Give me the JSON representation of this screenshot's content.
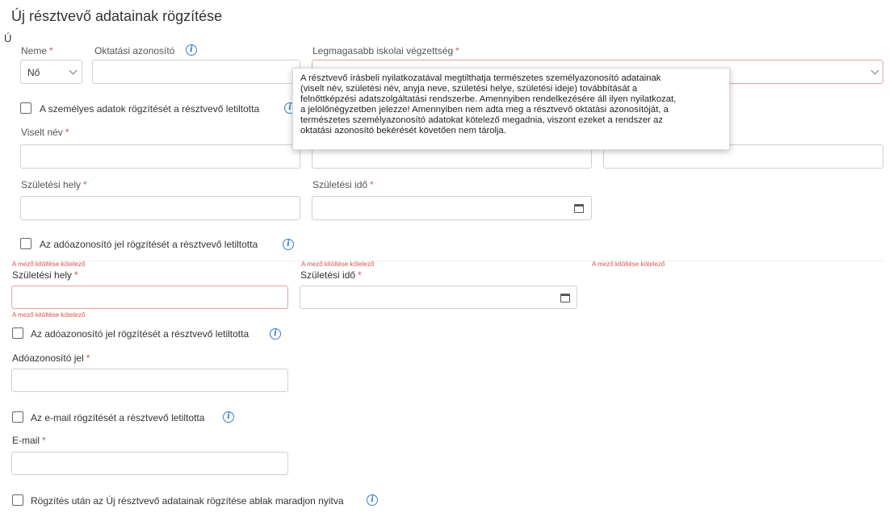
{
  "title": "Új résztvevő adatainak rögzítése",
  "stray_char": "Ú",
  "required_mark": "*",
  "gender": {
    "label": "Neme",
    "value": "Nő"
  },
  "education_id": {
    "label": "Oktatási azonosító"
  },
  "highest_education": {
    "label": "Legmagasabb iskolai végzettség"
  },
  "tooltip_lines": [
    "A résztvevő írásbeli nyilatkozatával megtilthatja természetes személyazonosító adatainak",
    "(viselt név, születési név, anyja neve, születési helye, születési ideje) továbbítását a",
    "felnőttképzési adatszolgáltatási rendszerbe. Amennyiben rendelkezésére áll ilyen nyilatkozat,",
    "a jelölőnégyzetben jelezze! Amennyiben nem adta meg a résztvevő oktatási azonosítóját, a",
    "természetes személyazonosító adatokat kötelező megadnia, viszont ezeket a rendszer az",
    "oktatási azonosító bekérését követően nem tárolja."
  ],
  "personal_block_cb": "A személyes adatok rögzítését a résztvevő letiltotta",
  "worn_name": {
    "label": "Viselt név"
  },
  "birth_place": {
    "label": "Születési hely"
  },
  "birth_date": {
    "label": "Születési idő"
  },
  "tax_block_cb": "Az adóazonosító jel rögzítését a résztvevő letiltotta",
  "required_error": "A mező kitöltése kötelező",
  "tax_id": {
    "label": "Adóazonosító jel"
  },
  "email_block_cb": "Az e-mail rögzítését a résztvevő letiltotta",
  "email": {
    "label": "E-mail"
  },
  "keep_open_cb": "Rögzítés után az Új résztvevő adatainak rögzítése ablak maradjon nyitva"
}
